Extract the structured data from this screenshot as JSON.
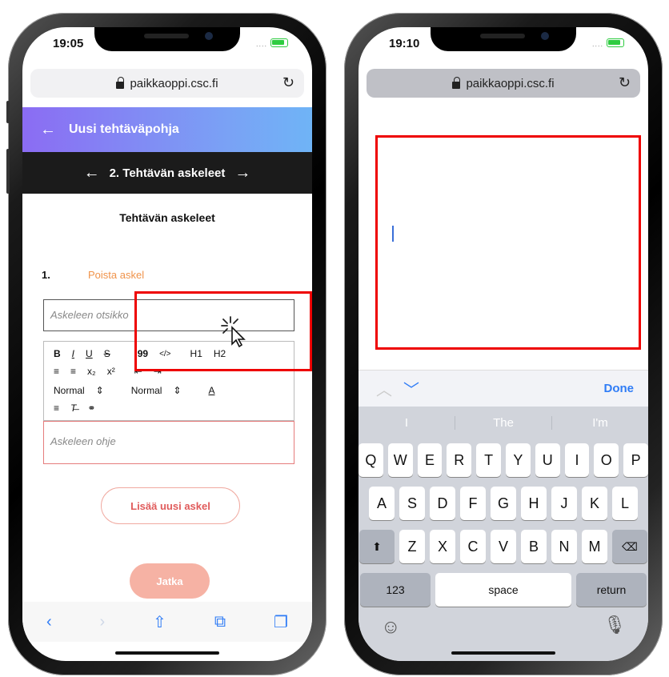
{
  "left_phone": {
    "status": {
      "time": "19:05"
    },
    "url": "paikkaoppi.csc.fi",
    "header_title": "Uusi tehtäväpohja",
    "step_nav_label": "2. Tehtävän askeleet",
    "section_title": "Tehtävän askeleet",
    "step_number": "1.",
    "delete_step_label": "Poista askel",
    "title_placeholder": "Askeleen otsikko",
    "toolbar": {
      "row1": [
        "B",
        "I",
        "U",
        "S",
        "99",
        "</>",
        "H1",
        "H2"
      ],
      "row2": [
        "≡",
        "≡",
        "x₂",
        "x²",
        "⇤",
        "⇥"
      ],
      "normal1": "Normal",
      "normal2": "Normal",
      "color_btn": "A"
    },
    "instructions_placeholder": "Askeleen ohje",
    "add_step_label": "Lisää uusi askel",
    "continue_label": "Jatka"
  },
  "right_phone": {
    "status": {
      "time": "19:10"
    },
    "url": "paikkaoppi.csc.fi",
    "done_label": "Done",
    "suggestions": [
      "I",
      "The",
      "I'm"
    ],
    "keys_row1": [
      "Q",
      "W",
      "E",
      "R",
      "T",
      "Y",
      "U",
      "I",
      "O",
      "P"
    ],
    "keys_row2": [
      "A",
      "S",
      "D",
      "F",
      "G",
      "H",
      "J",
      "K",
      "L"
    ],
    "keys_row3": [
      "Z",
      "X",
      "C",
      "V",
      "B",
      "N",
      "M"
    ],
    "num_key": "123",
    "space_key": "space",
    "return_key": "return"
  },
  "accent_colors": {
    "orange": "#f0934a",
    "red_highlight": "#e00000",
    "ios_blue": "#2f7cf6"
  }
}
